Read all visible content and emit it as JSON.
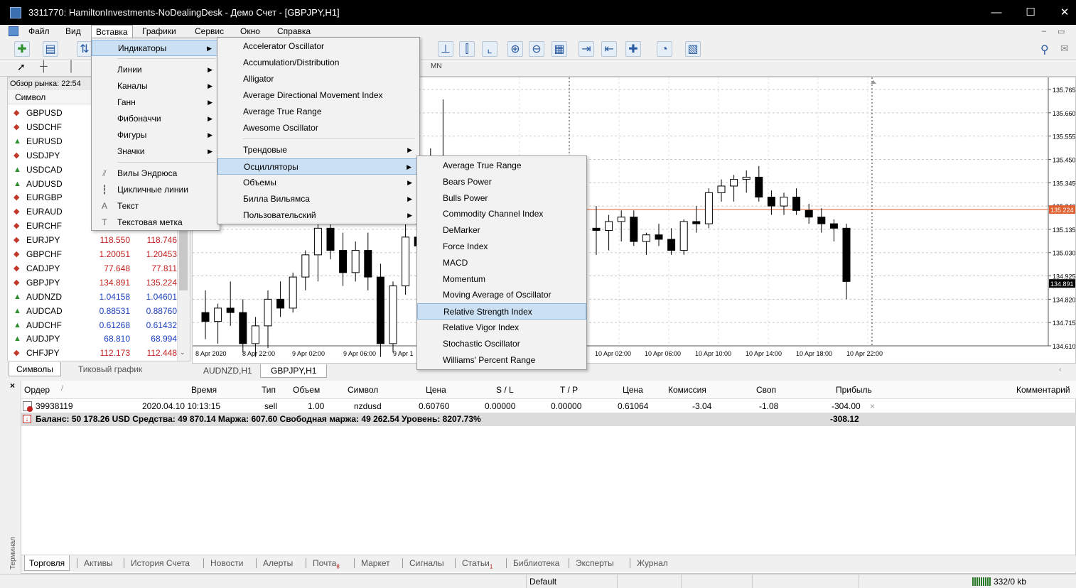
{
  "window": {
    "title": "3311770: HamiltonInvestments-NoDealingDesk - Демо Счет - [GBPJPY,H1]",
    "min": "—",
    "max": "☐",
    "close": "✕"
  },
  "menubar": {
    "items": [
      "Файл",
      "Вид",
      "Вставка",
      "Графики",
      "Сервис",
      "Окно",
      "Справка"
    ]
  },
  "toolbar2": {
    "timeframe_mn": "MN"
  },
  "market_watch": {
    "header": "Обзор рынка: 22:54",
    "column_symbol": "Символ",
    "rows": [
      {
        "symbol": "GBPUSD",
        "bid": "",
        "ask": "",
        "dir": "down"
      },
      {
        "symbol": "USDCHF",
        "bid": "",
        "ask": "",
        "dir": "down"
      },
      {
        "symbol": "EURUSD",
        "bid": "",
        "ask": "",
        "dir": "up"
      },
      {
        "symbol": "USDJPY",
        "bid": "",
        "ask": "",
        "dir": "down"
      },
      {
        "symbol": "USDCAD",
        "bid": "",
        "ask": "",
        "dir": "up"
      },
      {
        "symbol": "AUDUSD",
        "bid": "",
        "ask": "",
        "dir": "up"
      },
      {
        "symbol": "EURGBP",
        "bid": "",
        "ask": "",
        "dir": "down"
      },
      {
        "symbol": "EURAUD",
        "bid": "",
        "ask": "",
        "dir": "down"
      },
      {
        "symbol": "EURCHF",
        "bid": "",
        "ask": "",
        "dir": "down"
      },
      {
        "symbol": "EURJPY",
        "bid": "118.550",
        "ask": "118.746",
        "dir": "down"
      },
      {
        "symbol": "GBPCHF",
        "bid": "1.20051",
        "ask": "1.20453",
        "dir": "down"
      },
      {
        "symbol": "CADJPY",
        "bid": "77.648",
        "ask": "77.811",
        "dir": "down"
      },
      {
        "symbol": "GBPJPY",
        "bid": "134.891",
        "ask": "135.224",
        "dir": "down"
      },
      {
        "symbol": "AUDNZD",
        "bid": "1.04158",
        "ask": "1.04601",
        "dir": "up"
      },
      {
        "symbol": "AUDCAD",
        "bid": "0.88531",
        "ask": "0.88760",
        "dir": "up"
      },
      {
        "symbol": "AUDCHF",
        "bid": "0.61268",
        "ask": "0.61432",
        "dir": "up"
      },
      {
        "symbol": "AUDJPY",
        "bid": "68.810",
        "ask": "68.994",
        "dir": "up"
      },
      {
        "symbol": "CHFJPY",
        "bid": "112.173",
        "ask": "112.448",
        "dir": "down"
      }
    ],
    "tabs": [
      "Символы",
      "Тиковый график"
    ]
  },
  "chart": {
    "price_labels": [
      "135.765",
      "135.660",
      "135.555",
      "135.450",
      "135.345",
      "135.240",
      "135.135",
      "135.030",
      "134.925",
      "134.820",
      "134.715",
      "134.610"
    ],
    "current_bid": "135.224",
    "current_ask": "134.891",
    "time_labels_left": [
      "8 Apr 2020",
      "8 Apr 22:00",
      "9 Apr 02:00",
      "9 Apr 06:00",
      "9 Apr 1"
    ],
    "time_labels_right": [
      "10 Apr 02:00",
      "10 Apr 06:00",
      "10 Apr 10:00",
      "10 Apr 14:00",
      "10 Apr 18:00",
      "10 Apr 22:00"
    ],
    "tabs": [
      "AUDNZD,H1",
      "GBPJPY,H1"
    ],
    "candles": [
      {
        "o": 134.76,
        "h": 134.86,
        "l": 134.64,
        "c": 134.72
      },
      {
        "o": 134.72,
        "h": 134.8,
        "l": 134.62,
        "c": 134.78
      },
      {
        "o": 134.78,
        "h": 134.9,
        "l": 134.7,
        "c": 134.76
      },
      {
        "o": 134.76,
        "h": 134.82,
        "l": 134.58,
        "c": 134.62
      },
      {
        "o": 134.62,
        "h": 134.74,
        "l": 134.56,
        "c": 134.7
      },
      {
        "o": 134.7,
        "h": 134.86,
        "l": 134.6,
        "c": 134.82
      },
      {
        "o": 134.82,
        "h": 134.9,
        "l": 134.74,
        "c": 134.78
      },
      {
        "o": 134.78,
        "h": 134.94,
        "l": 134.76,
        "c": 134.92
      },
      {
        "o": 134.92,
        "h": 135.04,
        "l": 134.86,
        "c": 135.02
      },
      {
        "o": 135.02,
        "h": 135.2,
        "l": 134.9,
        "c": 135.14
      },
      {
        "o": 135.14,
        "h": 135.26,
        "l": 135.0,
        "c": 135.04
      },
      {
        "o": 135.04,
        "h": 135.12,
        "l": 134.88,
        "c": 134.94
      },
      {
        "o": 134.94,
        "h": 135.08,
        "l": 134.9,
        "c": 135.04
      },
      {
        "o": 135.04,
        "h": 135.12,
        "l": 134.86,
        "c": 134.92
      },
      {
        "o": 134.92,
        "h": 134.98,
        "l": 134.56,
        "c": 134.62
      },
      {
        "o": 134.62,
        "h": 134.9,
        "l": 134.58,
        "c": 134.88
      },
      {
        "o": 134.88,
        "h": 135.18,
        "l": 134.84,
        "c": 135.1
      },
      {
        "o": 135.1,
        "h": 135.2,
        "l": 135.0,
        "c": 135.06
      },
      {
        "o": 135.06,
        "h": 135.5,
        "l": 135.0,
        "c": 135.46
      },
      {
        "o": 135.46,
        "h": 135.72,
        "l": 135.36,
        "c": 135.42
      }
    ],
    "candles_right": [
      {
        "o": 135.14,
        "h": 135.24,
        "l": 135.02,
        "c": 135.13
      },
      {
        "o": 135.13,
        "h": 135.2,
        "l": 135.04,
        "c": 135.17
      },
      {
        "o": 135.17,
        "h": 135.22,
        "l": 135.08,
        "c": 135.19
      },
      {
        "o": 135.19,
        "h": 135.22,
        "l": 135.06,
        "c": 135.08
      },
      {
        "o": 135.08,
        "h": 135.12,
        "l": 135.02,
        "c": 135.11
      },
      {
        "o": 135.11,
        "h": 135.16,
        "l": 135.06,
        "c": 135.09
      },
      {
        "o": 135.09,
        "h": 135.14,
        "l": 135.02,
        "c": 135.04
      },
      {
        "o": 135.04,
        "h": 135.18,
        "l": 135.02,
        "c": 135.17
      },
      {
        "o": 135.17,
        "h": 135.24,
        "l": 135.12,
        "c": 135.16
      },
      {
        "o": 135.16,
        "h": 135.32,
        "l": 135.14,
        "c": 135.3
      },
      {
        "o": 135.3,
        "h": 135.36,
        "l": 135.26,
        "c": 135.33
      },
      {
        "o": 135.33,
        "h": 135.38,
        "l": 135.26,
        "c": 135.36
      },
      {
        "o": 135.36,
        "h": 135.4,
        "l": 135.3,
        "c": 135.37
      },
      {
        "o": 135.37,
        "h": 135.42,
        "l": 135.26,
        "c": 135.28
      },
      {
        "o": 135.28,
        "h": 135.31,
        "l": 135.2,
        "c": 135.24
      },
      {
        "o": 135.24,
        "h": 135.3,
        "l": 135.2,
        "c": 135.28
      },
      {
        "o": 135.28,
        "h": 135.32,
        "l": 135.2,
        "c": 135.22
      },
      {
        "o": 135.22,
        "h": 135.25,
        "l": 135.16,
        "c": 135.19
      },
      {
        "o": 135.19,
        "h": 135.23,
        "l": 135.12,
        "c": 135.16
      },
      {
        "o": 135.16,
        "h": 135.18,
        "l": 135.08,
        "c": 135.14
      },
      {
        "o": 135.14,
        "h": 135.16,
        "l": 134.82,
        "c": 134.9
      }
    ]
  },
  "menu_insert": {
    "items": [
      "Индикаторы",
      "Линии",
      "Каналы",
      "Ганн",
      "Фибоначчи",
      "Фигуры",
      "Значки",
      "Вилы Эндрюса",
      "Цикличные линии",
      "Текст",
      "Текстовая метка"
    ]
  },
  "menu_indicators": {
    "items": [
      "Accelerator Oscillator",
      "Accumulation/Distribution",
      "Alligator",
      "Average Directional Movement Index",
      "Average True Range",
      "Awesome Oscillator",
      "Трендовые",
      "Осцилляторы",
      "Объемы",
      "Билла Вильямса",
      "Пользовательский"
    ]
  },
  "menu_oscillators": {
    "items": [
      "Average True Range",
      "Bears Power",
      "Bulls Power",
      "Commodity Channel Index",
      "DeMarker",
      "Force Index",
      "MACD",
      "Momentum",
      "Moving Average of Oscillator",
      "Relative Strength Index",
      "Relative Vigor Index",
      "Stochastic Oscillator",
      "Williams' Percent Range"
    ],
    "highlighted": "Relative Strength Index"
  },
  "terminal": {
    "side_label": "Терминал",
    "columns": [
      "Ордер",
      "Время",
      "Тип",
      "Объем",
      "Символ",
      "Цена",
      "S / L",
      "T / P",
      "Цена",
      "Комиссия",
      "Своп",
      "Прибыль",
      "Комментарий"
    ],
    "order": {
      "ticket": "39938119",
      "time": "2020.04.10 10:13:15",
      "type": "sell",
      "volume": "1.00",
      "symbol": "nzdusd",
      "price_open": "0.60760",
      "sl": "0.00000",
      "tp": "0.00000",
      "price_now": "0.61064",
      "commission": "-3.04",
      "swap": "-1.08",
      "profit": "-304.00"
    },
    "summary": "Баланс: 50 178.26 USD  Средства: 49 870.14  Маржа: 607.60  Свободная маржа: 49 262.54  Уровень: 8207.73%",
    "summary_profit": "-308.12",
    "tabs": [
      {
        "label": "Торговля",
        "badge": ""
      },
      {
        "label": "Активы",
        "badge": ""
      },
      {
        "label": "История Счета",
        "badge": ""
      },
      {
        "label": "Новости",
        "badge": ""
      },
      {
        "label": "Алерты",
        "badge": ""
      },
      {
        "label": "Почта",
        "badge": "8"
      },
      {
        "label": "Маркет",
        "badge": ""
      },
      {
        "label": "Сигналы",
        "badge": ""
      },
      {
        "label": "Статьи",
        "badge": "1"
      },
      {
        "label": "Библиотека",
        "badge": ""
      },
      {
        "label": "Эксперты",
        "badge": ""
      },
      {
        "label": "Журнал",
        "badge": ""
      }
    ]
  },
  "statusbar": {
    "profile": "Default",
    "traffic": "332/0 kb"
  },
  "colors": {
    "bid_ask": "#c41e1e",
    "bid_ask_up": "#1a3fbf",
    "current_price_line": "#e06030",
    "menu_highlight": "#cce0f4"
  }
}
